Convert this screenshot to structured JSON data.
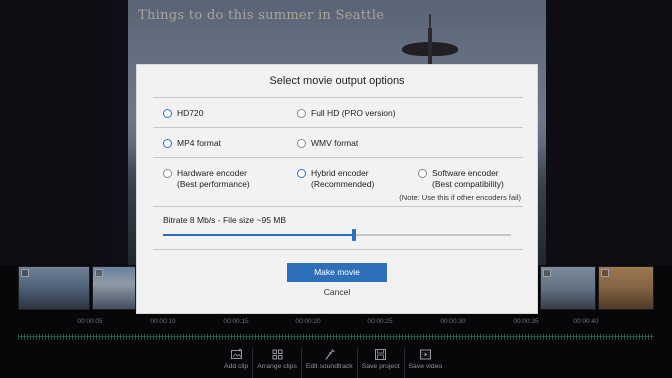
{
  "video": {
    "title": "Things to do this summer in Seattle"
  },
  "dialog": {
    "title": "Select movie output options",
    "resolution": {
      "options": [
        {
          "label": "HD720",
          "selected": true
        },
        {
          "label": "Full HD (PRO version)",
          "selected": false
        }
      ]
    },
    "format": {
      "options": [
        {
          "label": "MP4 format",
          "selected": true
        },
        {
          "label": "WMV format",
          "selected": false
        }
      ]
    },
    "encoder": {
      "options": [
        {
          "label": "Hardware encoder",
          "sub": "(Best performance)",
          "selected": false
        },
        {
          "label": "Hybrid encoder",
          "sub": "(Recommended)",
          "selected": true
        },
        {
          "label": "Software encoder",
          "sub": "(Best compatibility)",
          "selected": false
        }
      ],
      "note": "(Note: Use this if other encoders fail)"
    },
    "bitrate": {
      "label": "Bitrate 8 Mb/s - File size ~95 MB",
      "level": 0.55
    },
    "make_movie_label": "Make movie",
    "cancel_label": "Cancel"
  },
  "timeline": {
    "ticks": [
      "00:00:05",
      "00:00:10",
      "00:00:15",
      "00:00:20",
      "00:00:25",
      "00:00:30",
      "00:00:35",
      "00:00:40"
    ]
  },
  "toolbar": {
    "add_clip": "Add clip",
    "arrange_clips": "Arrange clips",
    "edit_soundtrack": "Edit soundtrack",
    "save_project": "Save project",
    "save_video": "Save video"
  },
  "colors": {
    "accent": "#2d6fb8",
    "waveform": "#3a8f6a"
  }
}
